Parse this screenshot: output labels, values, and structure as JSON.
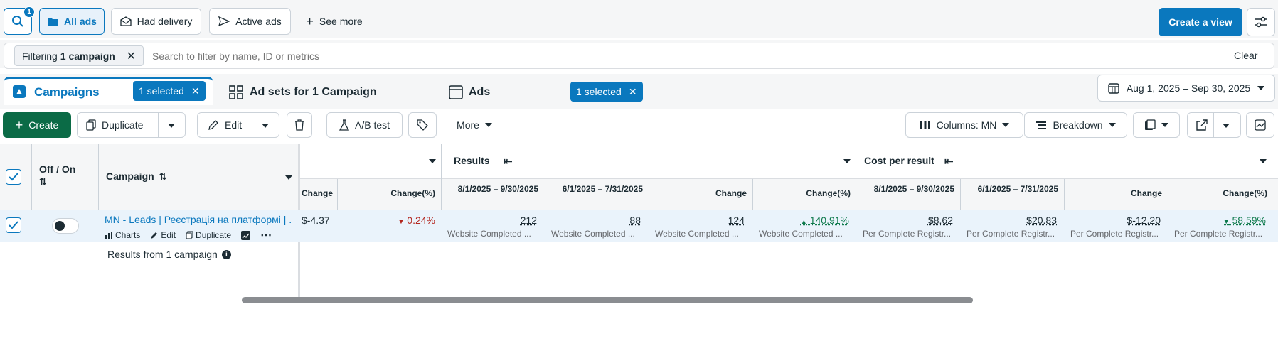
{
  "topbar": {
    "search_badge": "1",
    "views": [
      "All ads",
      "Had delivery",
      "Active ads"
    ],
    "see_more": "See more",
    "create_view": "Create a view"
  },
  "filterbar": {
    "chip_prefix": "Filtering",
    "chip_value": "1 campaign",
    "placeholder": "Search to filter by name, ID or metrics",
    "clear": "Clear"
  },
  "tabs": {
    "campaigns": "Campaigns",
    "campaigns_selected": "1 selected",
    "adsets": "Ad sets for 1 Campaign",
    "ads": "Ads",
    "ads_selected": "1 selected",
    "date_range": "Aug 1, 2025 – Sep 30, 2025"
  },
  "toolbar": {
    "create": "Create",
    "duplicate": "Duplicate",
    "edit": "Edit",
    "ab_test": "A/B test",
    "more": "More",
    "columns": "Columns: MN",
    "breakdown": "Breakdown"
  },
  "table": {
    "col_offon": "Off / On",
    "col_campaign": "Campaign",
    "group_results": "Results",
    "group_cost": "Cost per result",
    "sub_headers": {
      "change": "Change",
      "change_pct": "Change(%)",
      "period_a": "8/1/2025 – 9/30/2025",
      "period_b": "6/1/2025 – 7/31/2025"
    },
    "row": {
      "campaign_name": "MN - Leads | Реєстрація на платформі | ...",
      "actions": [
        "Charts",
        "Edit",
        "Duplicate"
      ],
      "prev_change": "$-4.37",
      "prev_change_pct": "0.24%",
      "results_a": "212",
      "results_b": "88",
      "results_change": "124",
      "results_change_pct": "140.91%",
      "results_label": "Website Completed ...",
      "cost_a": "$8.62",
      "cost_b": "$20.83",
      "cost_change": "$-12.20",
      "cost_change_pct": "58.59%",
      "cost_label": "Per Complete Registr..."
    },
    "footer": "Results from 1 campaign"
  },
  "colors": {
    "accent": "#0a78be",
    "create_green": "#0b6b46",
    "negative": "#b3261e",
    "positive": "#0f7a4c"
  }
}
